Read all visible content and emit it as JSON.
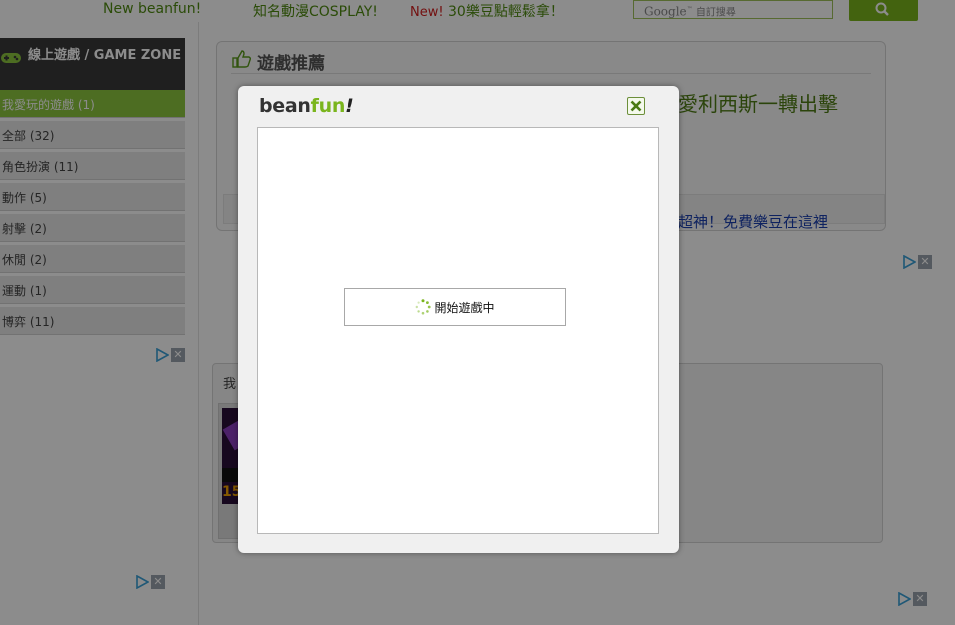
{
  "top_bar": {
    "link_1": "New beanfun!",
    "link_2": "知名動漫COSPLAY!",
    "link_3_new": "New!",
    "link_3": " 30樂豆點輕鬆拿！",
    "search_brand": "Google",
    "search_placeholder": "自訂搜尋",
    "search_button_icon": "search-icon"
  },
  "sidebar": {
    "header_title": "線上遊戲 / GAME ZONE",
    "header_icon": "gamepad-icon",
    "items": [
      {
        "label": "我愛玩的遊戲 (1)",
        "active": true
      },
      {
        "label": "全部 (32)"
      },
      {
        "label": "角色扮演 (11)"
      },
      {
        "label": "動作 (5)"
      },
      {
        "label": "射擊 (2)"
      },
      {
        "label": "休閒 (2)"
      },
      {
        "label": "運動 (1)"
      },
      {
        "label": "博弈 (11)"
      }
    ]
  },
  "recommend": {
    "title": "遊戲推薦",
    "title_icon": "thumbs-up-icon",
    "headline": "愛利西斯一轉出擊",
    "promo_link": "超神！免費樂豆在這裡"
  },
  "my_games": {
    "title": "我",
    "thumb_number": "15"
  },
  "modal": {
    "logo_bean": "bean",
    "logo_fun": "fun",
    "logo_bang": "!",
    "close_icon": "close-icon",
    "loading_text": "開始遊戲中"
  },
  "colors": {
    "accent_green": "#7ab51d",
    "nav_active": "#8cc63f",
    "link_blue": "#1a3fb0",
    "new_red": "#d21e1e"
  }
}
